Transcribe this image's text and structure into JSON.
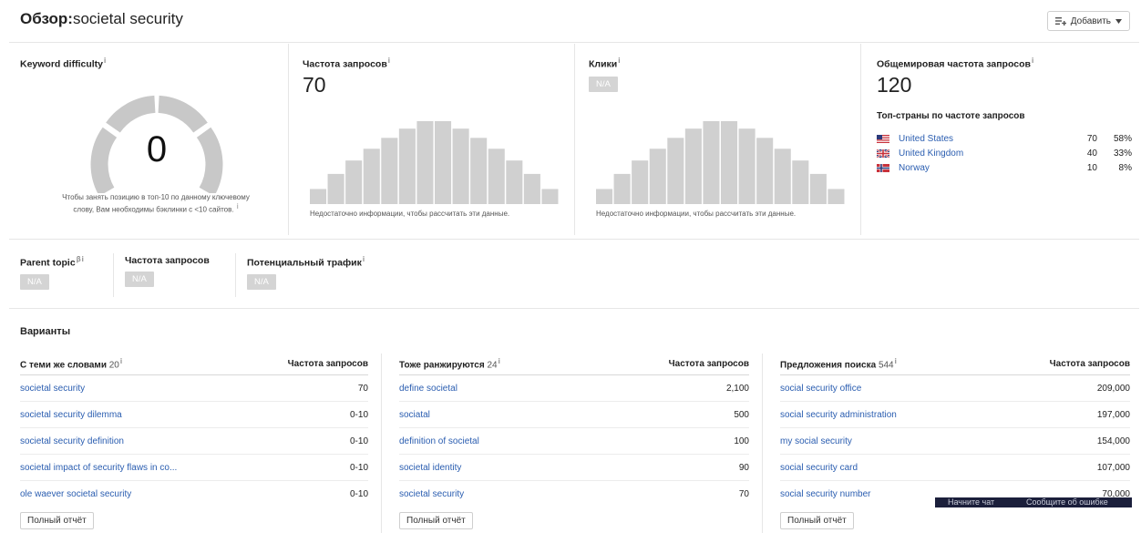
{
  "header": {
    "title_prefix": "Обзор:",
    "title_keyword": "societal security",
    "add_button": "Добавить",
    "add_icon": "list-add-icon",
    "dropdown_icon": "caret-down-icon"
  },
  "info_glyph": "i",
  "beta_glyph": "β",
  "keyword_difficulty": {
    "label": "Keyword difficulty",
    "value": "0",
    "note": "Чтобы занять позицию в топ-10 по данному ключевому слову, Вам необходимы бэклинки с <10 сайтов.",
    "gauge_color": "#c8c8c8"
  },
  "search_volume": {
    "label": "Частота запросов",
    "value": "70",
    "note": "Недостаточно информации, чтобы рассчитать эти данные.",
    "bar_levels": [
      0.18,
      0.36,
      0.52,
      0.66,
      0.79,
      0.9,
      0.99,
      0.99,
      0.9,
      0.79,
      0.66,
      0.52,
      0.36,
      0.18
    ],
    "bar_color": "#d0d0d0"
  },
  "clicks": {
    "label": "Клики",
    "value": "N/A",
    "note": "Недостаточно информации, чтобы рассчитать эти данные.",
    "bar_levels": [
      0.18,
      0.36,
      0.52,
      0.66,
      0.79,
      0.9,
      0.99,
      0.99,
      0.9,
      0.79,
      0.66,
      0.52,
      0.36,
      0.18
    ]
  },
  "global_volume": {
    "label": "Общемировая частота запросов",
    "value": "120",
    "top_countries_title": "Топ-страны по частоте запросов",
    "countries": [
      {
        "name": "United States",
        "volume": "70",
        "share": "58%",
        "flag_icon": "us-flag-icon"
      },
      {
        "name": "United Kingdom",
        "volume": "40",
        "share": "33%",
        "flag_icon": "uk-flag-icon"
      },
      {
        "name": "Norway",
        "volume": "10",
        "share": "8%",
        "flag_icon": "norway-flag-icon"
      }
    ]
  },
  "parent_topic": {
    "parent_label": "Parent topic",
    "parent_value": "N/A",
    "volume_label": "Частота запросов",
    "volume_value": "N/A",
    "traffic_label": "Потенциальный трафик",
    "traffic_value": "N/A"
  },
  "variants": {
    "title": "Варианты",
    "volume_header": "Частота запросов",
    "report_button": "Полный отчёт",
    "columns": [
      {
        "title": "С теми же словами",
        "count": "20",
        "rows": [
          {
            "keyword": "societal security",
            "volume": "70"
          },
          {
            "keyword": "societal security dilemma",
            "volume": "0-10"
          },
          {
            "keyword": "societal security definition",
            "volume": "0-10"
          },
          {
            "keyword": "societal impact of security flaws in co...",
            "volume": "0-10"
          },
          {
            "keyword": "ole waever societal security",
            "volume": "0-10"
          }
        ]
      },
      {
        "title": "Тоже ранжируются",
        "count": "24",
        "rows": [
          {
            "keyword": "define societal",
            "volume": "2,100"
          },
          {
            "keyword": "sociatal",
            "volume": "500"
          },
          {
            "keyword": "definition of societal",
            "volume": "100"
          },
          {
            "keyword": "societal identity",
            "volume": "90"
          },
          {
            "keyword": "societal security",
            "volume": "70"
          }
        ]
      },
      {
        "title": "Предложения поиска",
        "count": "544",
        "rows": [
          {
            "keyword": "social security office",
            "volume": "209,000"
          },
          {
            "keyword": "social security administration",
            "volume": "197,000"
          },
          {
            "keyword": "my social security",
            "volume": "154,000"
          },
          {
            "keyword": "social security card",
            "volume": "107,000"
          },
          {
            "keyword": "social security number",
            "volume": "70,000"
          }
        ]
      }
    ]
  },
  "chat_widget": {
    "start_chat": "Начните чат",
    "report_error": "Сообщите об ошибке"
  }
}
